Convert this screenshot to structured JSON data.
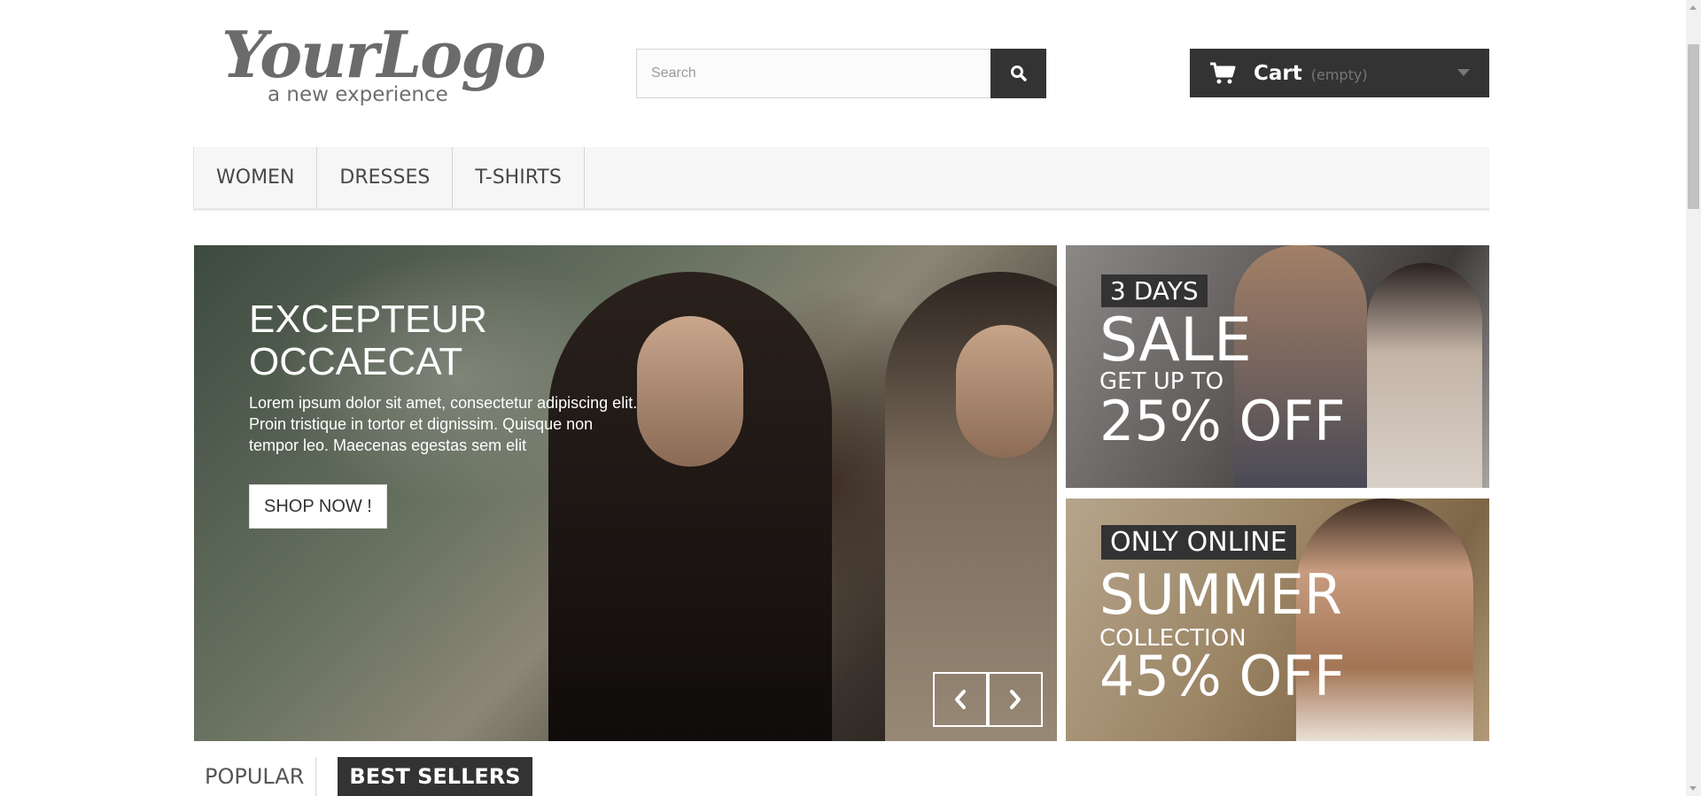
{
  "header": {
    "logo": {
      "script": "YourLogo",
      "tagline": "a new experience"
    },
    "search": {
      "placeholder": "Search",
      "value": "",
      "icon": "search-icon"
    },
    "cart": {
      "label": "Cart",
      "status": "(empty)",
      "icon": "cart-icon",
      "caret_icon": "caret-down-icon"
    }
  },
  "menu": {
    "items": [
      {
        "label": "WOMEN"
      },
      {
        "label": "DRESSES"
      },
      {
        "label": "T-SHIRTS"
      }
    ]
  },
  "slider": {
    "title": "EXCEPTEUR OCCAECAT",
    "text": "Lorem ipsum dolor sit amet, consectetur adipiscing elit. Proin tristique in tortor et dignissim. Quisque non tempor leo. Maecenas egestas sem elit",
    "button": "SHOP NOW !",
    "prev_icon": "chevron-left-icon",
    "next_icon": "chevron-right-icon"
  },
  "banners": [
    {
      "tag": "3 DAYS",
      "line1": "SALE",
      "line2": "GET UP TO",
      "line3": "25% OFF"
    },
    {
      "tag": "ONLY ONLINE",
      "line1": "SUMMER",
      "line2": "COLLECTION",
      "line3": "45% OFF"
    }
  ],
  "tabs": [
    {
      "label": "POPULAR",
      "active": false
    },
    {
      "label": "BEST SELLERS",
      "active": true
    }
  ],
  "colors": {
    "dark": "#333333",
    "menu_bg": "#f6f6f6",
    "border": "#d6d4d4"
  }
}
